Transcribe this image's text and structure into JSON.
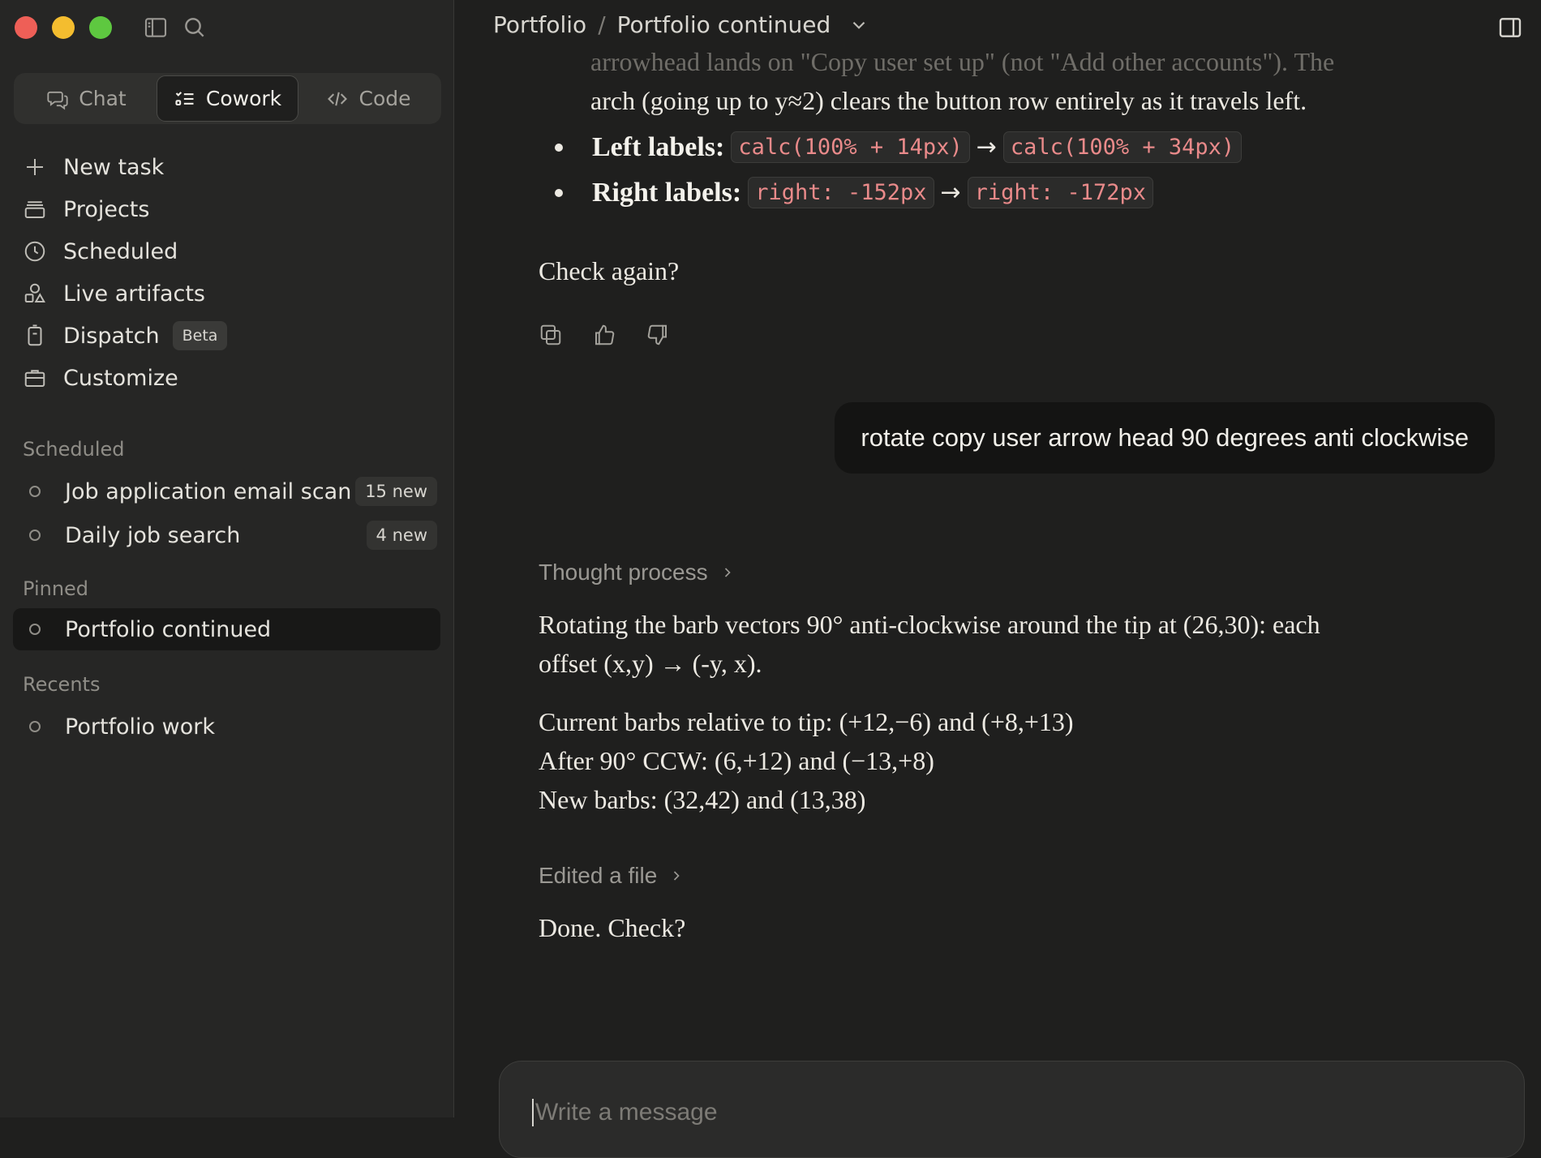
{
  "window": {
    "sidebar_toggle_icon": "sidebar-icon",
    "search_icon": "search-icon"
  },
  "modes": [
    {
      "label": "Chat",
      "icon": "chat-bubbles-icon",
      "active": false
    },
    {
      "label": "Cowork",
      "icon": "checklist-icon",
      "active": true
    },
    {
      "label": "Code",
      "icon": "code-icon",
      "active": false
    }
  ],
  "nav": {
    "new_task": "New task",
    "projects": "Projects",
    "scheduled": "Scheduled",
    "live_artifacts": "Live artifacts",
    "dispatch": "Dispatch",
    "dispatch_badge": "Beta",
    "customize": "Customize"
  },
  "sections": {
    "scheduled": {
      "title": "Scheduled",
      "items": [
        {
          "label": "Job application email scan",
          "badge": "15 new"
        },
        {
          "label": "Daily job search",
          "badge": "4 new"
        }
      ]
    },
    "pinned": {
      "title": "Pinned",
      "items": [
        {
          "label": "Portfolio continued"
        }
      ]
    },
    "recents": {
      "title": "Recents",
      "items": [
        {
          "label": "Portfolio work"
        }
      ]
    }
  },
  "header": {
    "project": "Portfolio",
    "separator": "/",
    "conversation": "Portfolio continued"
  },
  "conversation": {
    "faded_line": "arrowhead lands on \"Copy user set up\" (not \"Add other accounts\"). The",
    "arch_line": "arch (going up to y≈2) clears the button row entirely as it travels left.",
    "left_labels": {
      "label": "Left labels:",
      "from": "calc(100% + 14px)",
      "to": "calc(100% + 34px)"
    },
    "right_labels": {
      "label": "Right labels:",
      "from": "right: -152px",
      "to": "right: -172px"
    },
    "arrow": "→",
    "check_again": "Check again?",
    "user_message": "rotate copy user arrow head 90 degrees anti clockwise",
    "thought_process": "Thought process",
    "answer_p1_line1": "Rotating the barb vectors 90° anti-clockwise around the tip at (26,30): each",
    "answer_p1_line2": "offset (x,y) → (-y, x).",
    "answer_p2_line1": "Current barbs relative to tip: (+12,−6) and (+8,+13)",
    "answer_p2_line2": "After 90° CCW: (6,+12) and (−13,+8)",
    "answer_p2_line3": "New barbs: (32,42) and (13,38)",
    "edited_file": "Edited a file",
    "done": "Done. Check?"
  },
  "composer": {
    "placeholder": "Write a message"
  },
  "colors": {
    "background": "#1f1f1e",
    "sidebar": "#262625",
    "code_text": "#e98a8a"
  }
}
